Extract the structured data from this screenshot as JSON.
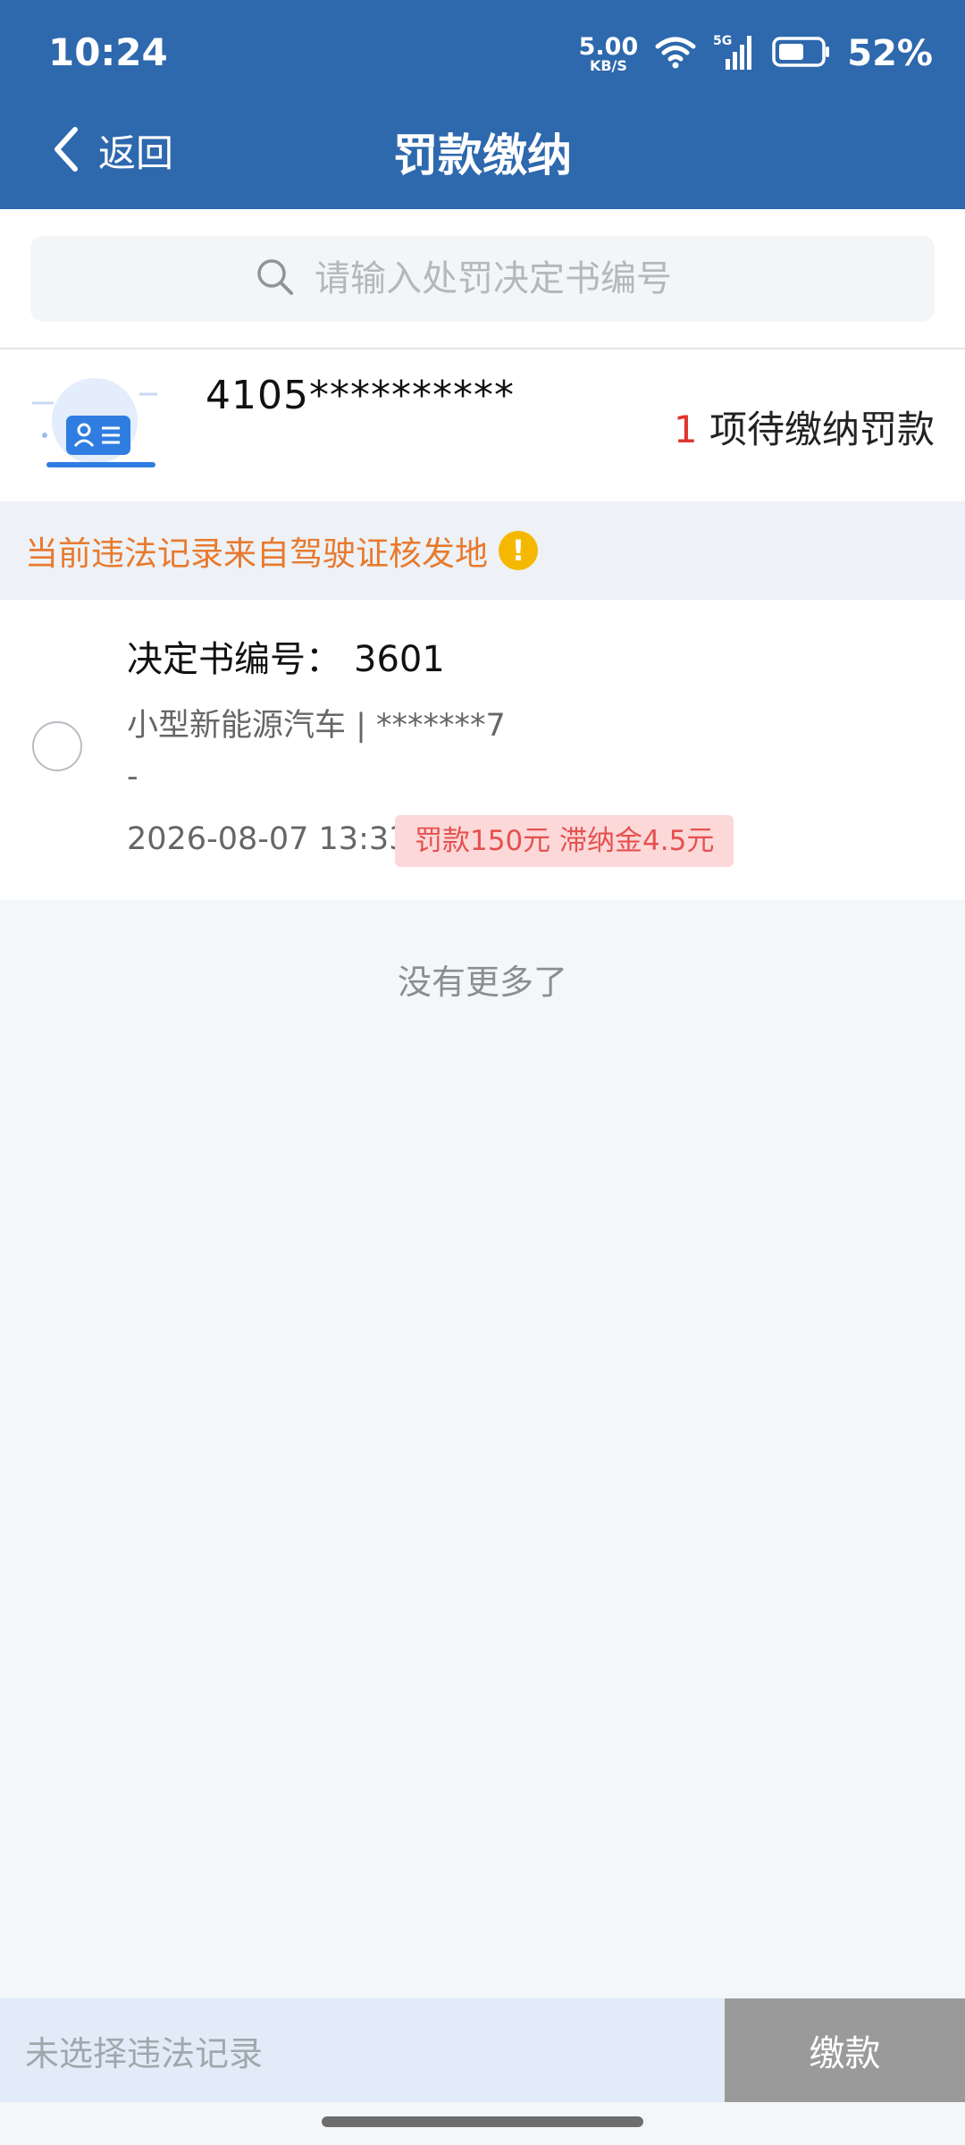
{
  "status_bar": {
    "time": "10:24",
    "net_speed": "5.00",
    "net_unit": "KB/S",
    "signal_label": "5G",
    "battery": "52%"
  },
  "nav": {
    "back_label": "返回",
    "title": "罚款缴纳"
  },
  "search": {
    "placeholder": "请输入处罚决定书编号"
  },
  "license": {
    "number": "4105**********",
    "pending_count": "1",
    "pending_label": "项待缴纳罚款"
  },
  "notice": {
    "text": "当前违法记录来自驾驶证核发地",
    "icon": "!"
  },
  "records": [
    {
      "decision_label": "决定书编号：",
      "decision_number": "3601",
      "vehicle": "小型新能源汽车 | *******7",
      "location": "-",
      "datetime": "2026-08-07 13:33",
      "fine": "罚款150元 滞纳金4.5元"
    }
  ],
  "list_end": "没有更多了",
  "bottom": {
    "selection_status": "未选择违法记录",
    "pay_label": "缴款"
  },
  "colors": {
    "header": "#2e68ad",
    "accent_red": "#e0342f",
    "notice_orange": "#e87a2f",
    "warning_yellow": "#f5b800"
  },
  "icons": [
    "chevron-left-icon",
    "wifi-icon",
    "signal-icon",
    "battery-icon",
    "search-icon",
    "id-card-icon",
    "warning-icon"
  ]
}
